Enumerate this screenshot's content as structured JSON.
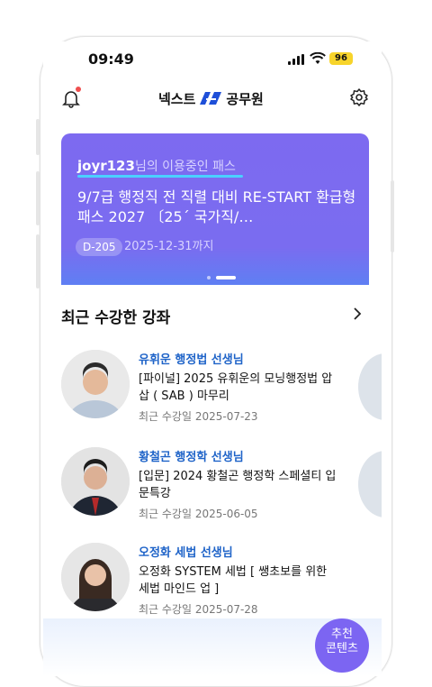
{
  "status_bar": {
    "time": "09:49",
    "battery": "96"
  },
  "header": {
    "brand_left": "넥스트",
    "brand_right": "공무원"
  },
  "banner": {
    "user": "joyr123",
    "user_suffix": "님의 이용중인 패스",
    "title": "9/7급 행정직 전 직렬 대비 RE-START 환급형 패스 2027 〔25´ 국가직/…",
    "d_badge": "D-205",
    "expiry": "2025-12-31까지"
  },
  "recent": {
    "title": "최근 수강한 강좌",
    "courses": [
      {
        "teacher": "유휘운 행정법 선생님",
        "title": "[파이널] 2025 유휘운의 모닝행정법 압삽 ( SAB ) 마무리",
        "date": "최근 수강일 2025-07-23"
      },
      {
        "teacher": "황철곤 행정학 선생님",
        "title": "[입문] 2024 황철곤 행정학 스페셜티 입문특강",
        "date": "최근 수강일 2025-06-05"
      },
      {
        "teacher": "오정화 세법 선생님",
        "title": "오정화 SYSTEM 세법 [ 쌩초보를 위한 세법 마인드 업 ]",
        "date": "최근 수강일 2025-07-28"
      }
    ]
  },
  "recommend_button": {
    "line1": "추천",
    "line2": "콘텐츠"
  },
  "colors": {
    "accent": "#7c65f2",
    "teacher_text": "#1e63c8",
    "battery": "#f7d42b"
  }
}
